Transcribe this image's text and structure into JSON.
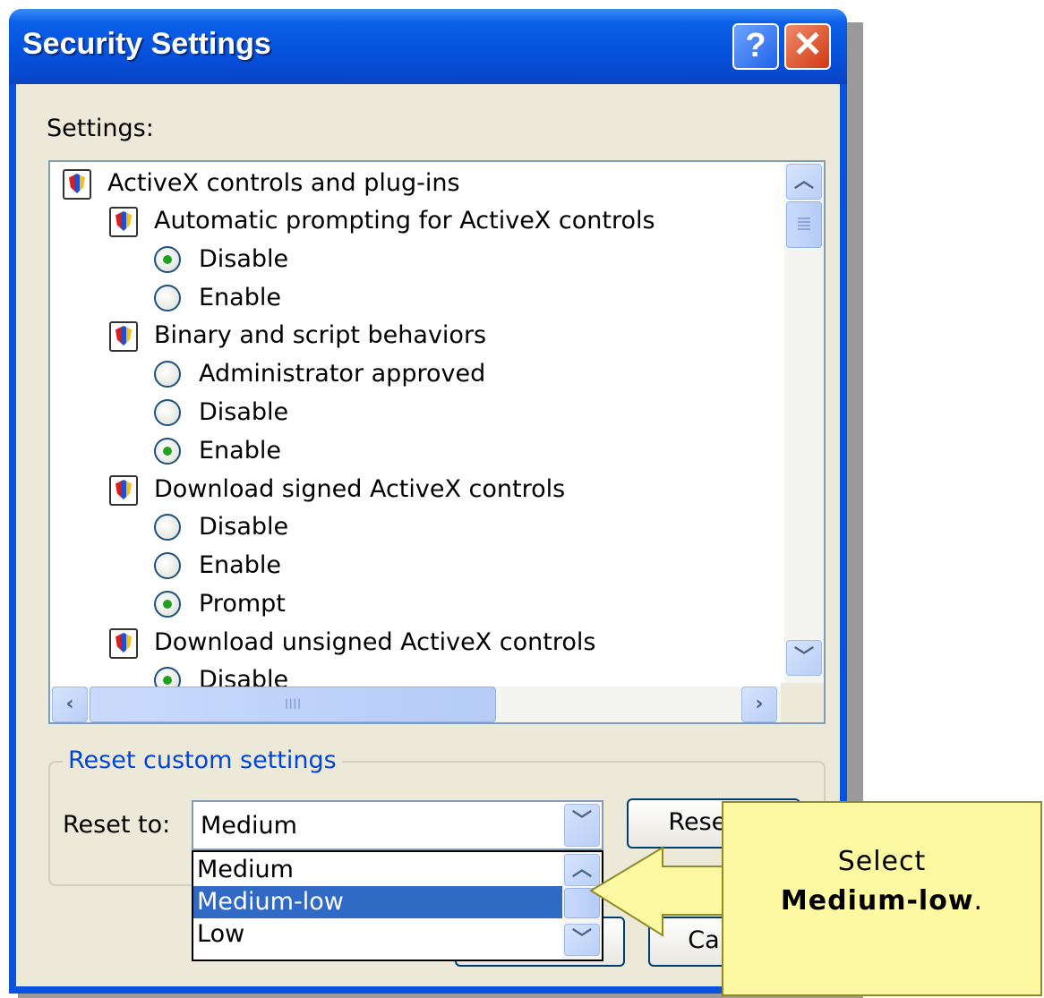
{
  "window": {
    "title": "Security Settings",
    "help_button": "?",
    "close_button": "✕"
  },
  "settings": {
    "label": "Settings:",
    "items": [
      {
        "kind": "category",
        "label": "ActiveX controls and plug-ins"
      },
      {
        "kind": "setting",
        "label": "Automatic prompting for ActiveX controls"
      },
      {
        "kind": "option",
        "label": "Disable",
        "checked": true
      },
      {
        "kind": "option",
        "label": "Enable",
        "checked": false
      },
      {
        "kind": "setting",
        "label": "Binary and script behaviors"
      },
      {
        "kind": "option",
        "label": "Administrator approved",
        "checked": false
      },
      {
        "kind": "option",
        "label": "Disable",
        "checked": false
      },
      {
        "kind": "option",
        "label": "Enable",
        "checked": true
      },
      {
        "kind": "setting",
        "label": "Download signed ActiveX controls"
      },
      {
        "kind": "option",
        "label": "Disable",
        "checked": false
      },
      {
        "kind": "option",
        "label": "Enable",
        "checked": false
      },
      {
        "kind": "option",
        "label": "Prompt",
        "checked": true
      },
      {
        "kind": "setting",
        "label": "Download unsigned ActiveX controls"
      },
      {
        "kind": "option",
        "label": "Disable",
        "checked": true
      }
    ],
    "hscroll_grip": "IIII",
    "vscroll_grip": "≣"
  },
  "reset": {
    "group_title": "Reset custom settings",
    "reset_to_label": "Reset to:",
    "selected": "Medium",
    "options": [
      "Medium",
      "Medium-low",
      "Low"
    ],
    "highlighted": "Medium-low",
    "reset_button": "Reset...",
    "cancel_button": "Cancel"
  },
  "callout": {
    "line1": "Select",
    "line2_bold": "Medium-low",
    "line2_suffix": "."
  },
  "colors": {
    "titlebar": "#0653dd",
    "selection": "#316ac5",
    "callout_bg": "#fdf9a3",
    "group_title": "#0046d5"
  }
}
